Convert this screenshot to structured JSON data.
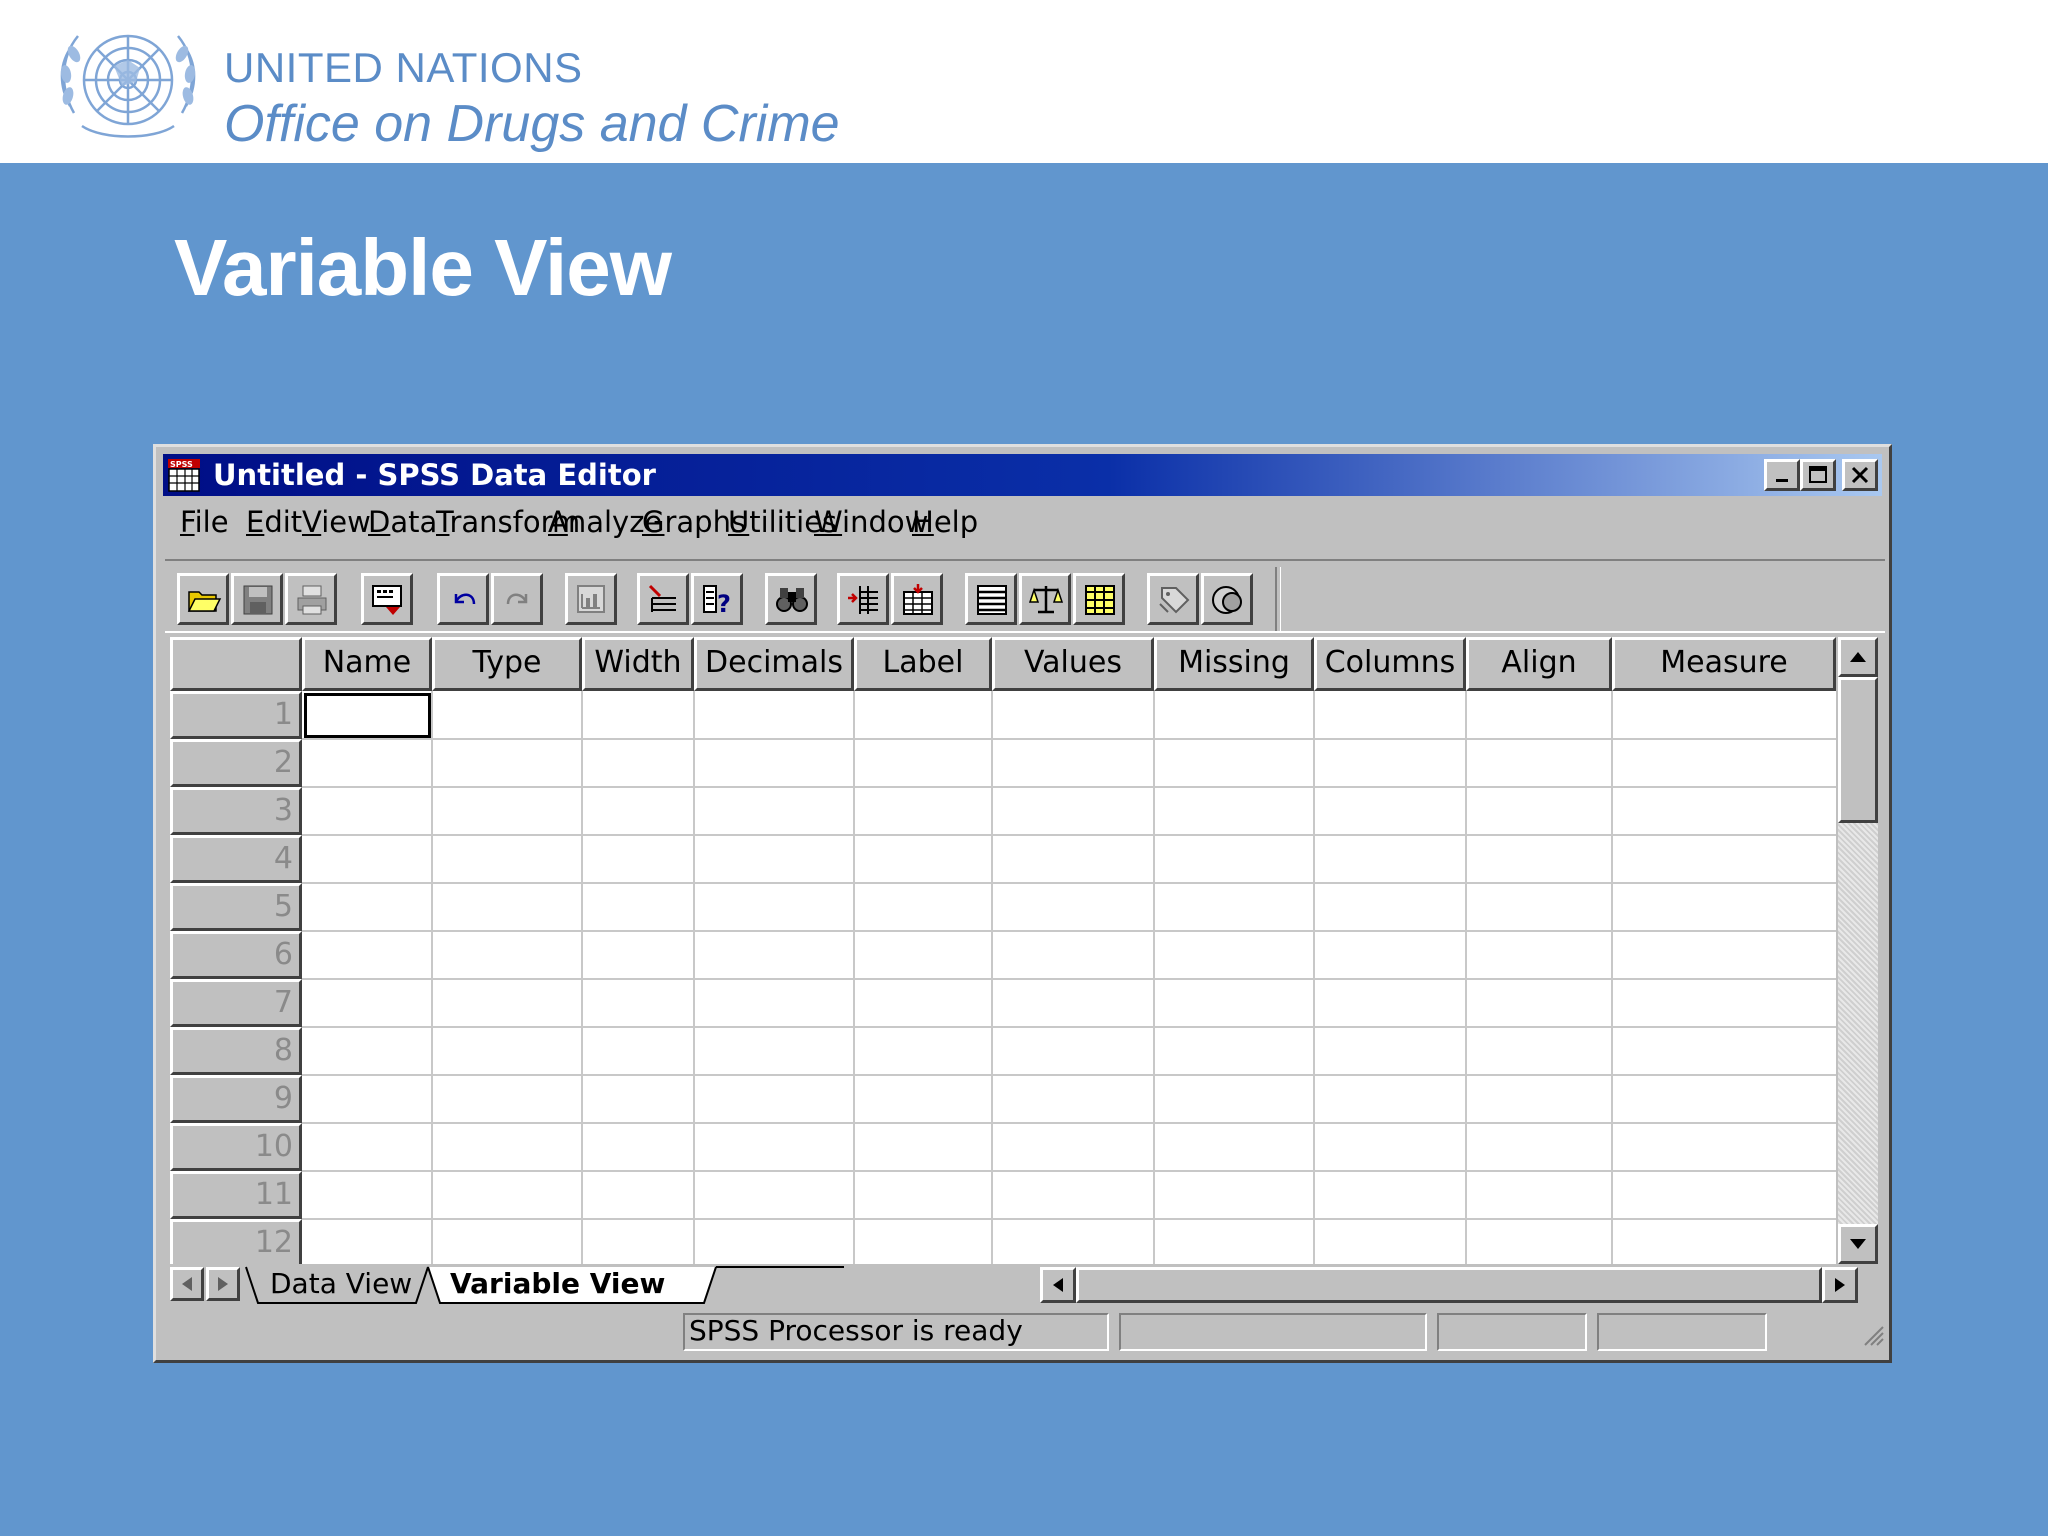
{
  "slide": {
    "org_line1": "UNITED NATIONS",
    "org_line2": "Office on Drugs and Crime",
    "title": "Variable View"
  },
  "colors": {
    "slide_background": "#6196ce",
    "header_background": "#ffffff",
    "org_text": "#5b8cc7",
    "titlebar_start": "#000e86",
    "titlebar_end": "#a9c8f0",
    "window_face": "#c0c0c0"
  },
  "window": {
    "app_icon": "spss-data-editor-icon",
    "title": "Untitled - SPSS Data Editor",
    "controls": [
      "minimize-icon",
      "maximize-icon",
      "close-icon"
    ]
  },
  "menu": [
    {
      "label": "File",
      "accel": "F"
    },
    {
      "label": "Edit",
      "accel": "E"
    },
    {
      "label": "View",
      "accel": "V"
    },
    {
      "label": "Data",
      "accel": "D"
    },
    {
      "label": "Transform",
      "accel": "T"
    },
    {
      "label": "Analyze",
      "accel": "A"
    },
    {
      "label": "Graphs",
      "accel": "G"
    },
    {
      "label": "Utilities",
      "accel": "U"
    },
    {
      "label": "Window",
      "accel": "W"
    },
    {
      "label": "Help",
      "accel": "H"
    }
  ],
  "toolbar": [
    {
      "icon": "open-folder-icon"
    },
    {
      "icon": "save-icon"
    },
    {
      "icon": "print-icon"
    },
    {
      "icon": "dialog-recall-icon"
    },
    {
      "icon": "undo-icon"
    },
    {
      "icon": "redo-icon"
    },
    {
      "icon": "goto-chart-icon"
    },
    {
      "icon": "goto-case-icon"
    },
    {
      "icon": "variables-info-icon"
    },
    {
      "icon": "find-icon"
    },
    {
      "icon": "insert-case-icon"
    },
    {
      "icon": "insert-variable-icon"
    },
    {
      "icon": "split-file-icon"
    },
    {
      "icon": "weight-cases-icon"
    },
    {
      "icon": "select-cases-icon"
    },
    {
      "icon": "value-labels-icon"
    },
    {
      "icon": "use-sets-icon"
    }
  ],
  "grid": {
    "columns": [
      "Name",
      "Type",
      "Width",
      "Decimals",
      "Label",
      "Values",
      "Missing",
      "Columns",
      "Align",
      "Measure"
    ],
    "rows": [
      "1",
      "2",
      "3",
      "4",
      "5",
      "6",
      "7",
      "8",
      "9",
      "10",
      "11",
      "12"
    ],
    "active_cell": {
      "row": "1",
      "column": "Name"
    }
  },
  "tabs": {
    "items": [
      "Data View",
      "Variable View"
    ],
    "active": "Variable View"
  },
  "status": {
    "message": "SPSS Processor  is ready"
  }
}
